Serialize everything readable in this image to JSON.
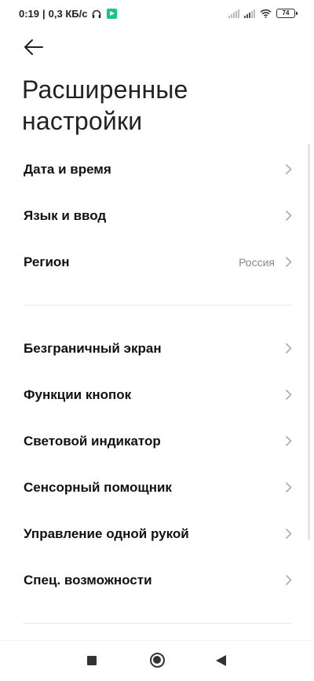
{
  "status_bar": {
    "time": "0:19",
    "network_speed": "0,3 КБ/с",
    "battery": "74",
    "icons": [
      "headset-icon",
      "app-notification-icon",
      "signal-icon",
      "wifi-icon",
      "battery-icon"
    ]
  },
  "header": {
    "back_icon": "arrow-left-icon",
    "title_line1": "Расширенные",
    "title_line2": "настройки"
  },
  "sections": [
    {
      "items": [
        {
          "label": "Дата и время",
          "value": ""
        },
        {
          "label": "Язык и ввод",
          "value": ""
        },
        {
          "label": "Регион",
          "value": "Россия"
        }
      ]
    },
    {
      "items": [
        {
          "label": "Безграничный экран",
          "value": ""
        },
        {
          "label": "Функции кнопок",
          "value": ""
        },
        {
          "label": "Световой индикатор",
          "value": ""
        },
        {
          "label": "Сенсорный помощник",
          "value": ""
        },
        {
          "label": "Управление одной рукой",
          "value": ""
        },
        {
          "label": "Спец. возможности",
          "value": ""
        }
      ]
    }
  ],
  "nav_bar": {
    "icons": [
      "recent-apps-icon",
      "home-icon",
      "back-triangle-icon"
    ]
  }
}
